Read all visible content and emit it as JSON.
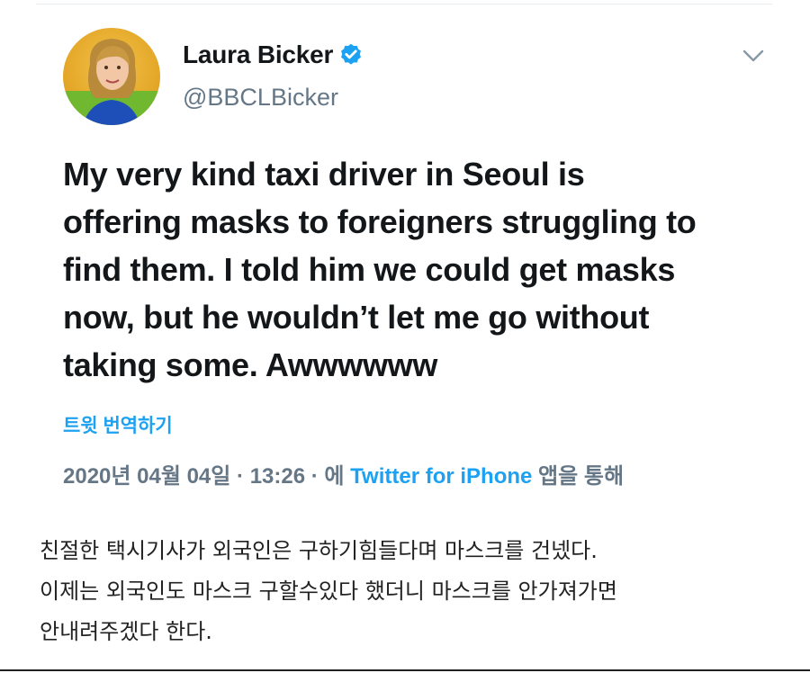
{
  "tweet": {
    "author_name": "Laura Bicker",
    "handle": "@BBCLBicker",
    "avatar_icon": "profile-photo",
    "verified_icon": "verified-badge-icon",
    "menu_icon": "chevron-down-icon",
    "text_lines": [
      "My very kind taxi driver in Seoul is",
      "offering masks to foreigners struggling to",
      "find them. I told him we could get masks",
      "now, but he wouldn’t let me go without",
      "taking some. Awwwwww"
    ],
    "translate_label": "트윗 번역하기",
    "meta": {
      "date": "2020년 04월 04일",
      "separator1": " · ",
      "time": "13:26",
      "separator2": " · ",
      "prefix": "에 ",
      "source": "Twitter for iPhone",
      "suffix": " 앱을 통해"
    }
  },
  "caption": {
    "lines": [
      "친절한 택시기사가 외국인은 구하기힘들다며 마스크를 건넸다.",
      "이제는 외국인도 마스크 구할수있다 했더니 마스크를 안가져가면",
      "안내려주겠다 한다."
    ]
  },
  "colors": {
    "accent": "#1da1f2",
    "text": "#14171a",
    "muted": "#657786"
  }
}
